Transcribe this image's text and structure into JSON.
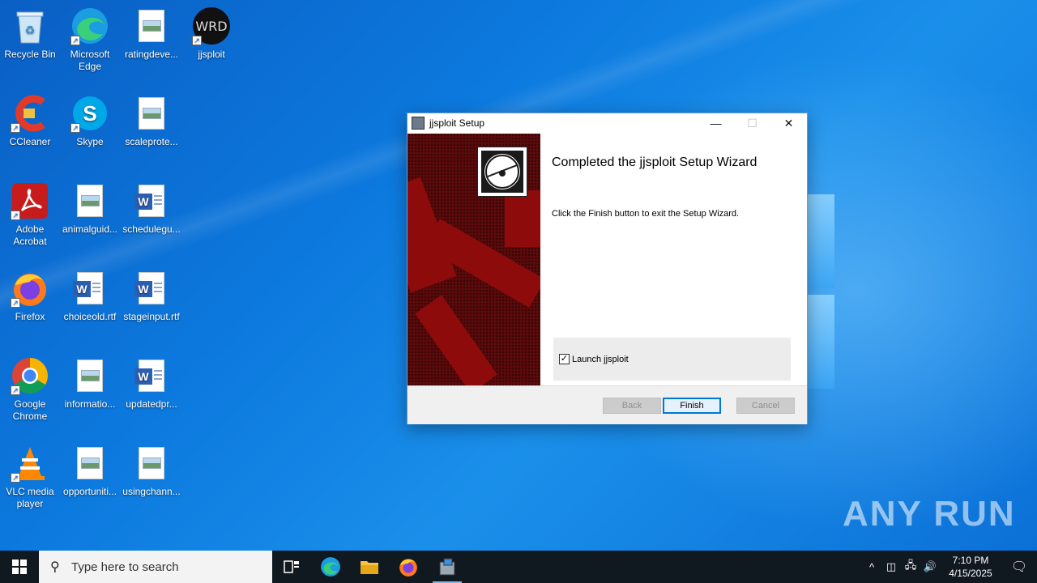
{
  "desktop": {
    "icons": [
      {
        "label": "Recycle Bin",
        "icon": "recycle-bin-icon"
      },
      {
        "label": "Microsoft Edge",
        "icon": "edge-icon"
      },
      {
        "label": "ratingdeve...",
        "icon": "image-file-icon"
      },
      {
        "label": "jjsploit",
        "icon": "jjsploit-icon"
      },
      {
        "label": "CCleaner",
        "icon": "ccleaner-icon"
      },
      {
        "label": "Skype",
        "icon": "skype-icon"
      },
      {
        "label": "scaleprote...",
        "icon": "image-file-icon"
      },
      {
        "label": "Adobe Acrobat",
        "icon": "acrobat-icon"
      },
      {
        "label": "animalguid...",
        "icon": "image-file-icon"
      },
      {
        "label": "schedulegu...",
        "icon": "word-doc-icon"
      },
      {
        "label": "Firefox",
        "icon": "firefox-icon"
      },
      {
        "label": "choiceold.rtf",
        "icon": "word-doc-icon"
      },
      {
        "label": "stageinput.rtf",
        "icon": "word-doc-icon"
      },
      {
        "label": "Google Chrome",
        "icon": "chrome-icon"
      },
      {
        "label": "informatio...",
        "icon": "image-file-icon"
      },
      {
        "label": "updatedpr...",
        "icon": "word-doc-icon"
      },
      {
        "label": "VLC media player",
        "icon": "vlc-icon"
      },
      {
        "label": "opportuniti...",
        "icon": "image-file-icon"
      },
      {
        "label": "usingchann...",
        "icon": "image-file-icon"
      }
    ]
  },
  "dialog": {
    "title": "jjsploit Setup",
    "minimize": "—",
    "maximize": "☐",
    "close": "✕",
    "heading": "Completed the jjsploit Setup Wizard",
    "description": "Click the Finish button to exit the Setup Wizard.",
    "checkbox_label": "Launch jjsploit",
    "checkbox_checked": true,
    "checkbox_mark": "✓",
    "buttons": {
      "back": "Back",
      "finish": "Finish",
      "cancel": "Cancel"
    }
  },
  "watermark": "ANY RUN",
  "taskbar": {
    "search_placeholder": "Type here to search",
    "time": "7:10 PM",
    "date": "4/15/2025"
  }
}
